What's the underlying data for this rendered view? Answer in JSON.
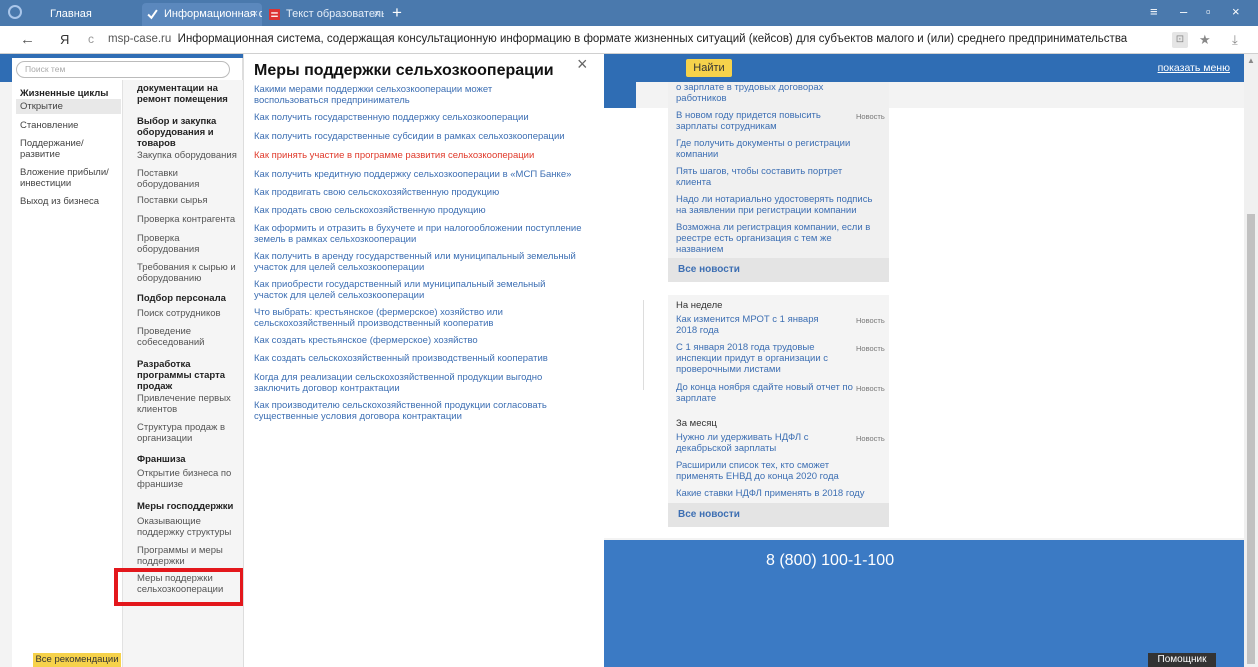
{
  "browser": {
    "tabs": [
      {
        "label": "Главная"
      },
      {
        "label": "Информационная систе",
        "close": "×"
      },
      {
        "label": "Текст образовательного ко",
        "close": "×"
      }
    ],
    "new_tab": "+",
    "window_controls": [
      "≡",
      "–",
      "▫",
      "×"
    ],
    "nav_back": "←",
    "nav_logo": "Я",
    "nav_reload": "c",
    "url_domain": "msp-case.ru",
    "url_title": "Информационная система, содержащая консультационную информацию в формате жизненных ситуаций (кейсов) для субъектов малого и (или) среднего предпринимательства",
    "bookmark": "★",
    "download": "⤓"
  },
  "header": {
    "search_placeholder": "Поиск тем",
    "find_button": "Найти",
    "show_menu": "показать меню"
  },
  "sidebar": {
    "title": "Жизненные циклы",
    "items": [
      "Открытие",
      "Становление",
      "Поддержание/ развитие",
      "Вложение прибыли/ инвестиции",
      "Выход из бизнеса"
    ],
    "sub": [
      {
        "t": "документации на ремонт помещения",
        "h": true
      },
      {
        "t": "Выбор и закупка оборудования и товаров",
        "h": true
      },
      {
        "t": "Закупка оборудования"
      },
      {
        "t": "Поставки оборудования"
      },
      {
        "t": "Поставки сырья"
      },
      {
        "t": "Проверка контрагента"
      },
      {
        "t": "Проверка оборудования"
      },
      {
        "t": "Требования к сырью и оборудованию"
      },
      {
        "t": "Подбор персонала",
        "h": true
      },
      {
        "t": "Поиск сотрудников"
      },
      {
        "t": "Проведение собеседований"
      },
      {
        "t": "Разработка программы старта продаж",
        "h": true
      },
      {
        "t": "Привлечение первых клиентов"
      },
      {
        "t": "Структура продаж в организации"
      },
      {
        "t": "Франшиза",
        "h": true
      },
      {
        "t": "Открытие бизнеса по франшизе"
      },
      {
        "t": "Меры господдержки",
        "h": true
      },
      {
        "t": "Оказывающие поддержку структуры"
      },
      {
        "t": "Программы и меры поддержки"
      },
      {
        "t": "Меры поддержки сельхозкооперации"
      }
    ],
    "all_recommendations": "Все рекомендации"
  },
  "popup": {
    "title": "Меры поддержки сельхозкооперации",
    "close": "×",
    "links": [
      "Какими мерами поддержки сельхозкооперации может воспользоваться предприниматель",
      "Как получить государственную поддержку сельхозкооперации",
      "Как получить государственные субсидии в рамках сельхозкооперации",
      "Как принять участие в программе развития сельхозкооперации",
      "Как получить кредитную поддержку сельхозкооперации в «МСП Банке»",
      "Как продвигать свою сельскохозяйственную продукцию",
      "Как продать свою сельскохозяйственную продукцию",
      "Как оформить и отразить в бухучете и при налогообложении поступление земель в рамках сельхозкооперации",
      "Как получить в аренду государственный или муниципальный земельный участок для целей сельхозкооперации",
      "Как приобрести государственный или муниципальный земельный участок для целей сельхозкооперации",
      "Что выбрать: крестьянское (фермерское) хозяйство или сельскохозяйственный производственный кооператив",
      "Как создать крестьянское (фермерское) хозяйство",
      "Как создать сельскохозяйственный производственный кооператив",
      "Когда для реализации сельскохозяйственной продукции выгодно заключить договор контрактации",
      "Как производителю сельскохозяйственной продукции согласовать существенные условия договора контрактации"
    ],
    "active_index": 3
  },
  "news": {
    "items": [
      {
        "t": "о зарплате в трудовых договорах работников",
        "badge": ""
      },
      {
        "t": "В новом году придется повысить зарплаты сотрудникам",
        "badge": "Новость"
      },
      {
        "t": "Где получить документы о регистрации компании",
        "badge": ""
      },
      {
        "t": "Пять шагов, чтобы составить портрет клиента",
        "badge": ""
      },
      {
        "t": "Надо ли нотариально удостоверять подпись на заявлении при регистрации компании",
        "badge": ""
      },
      {
        "t": "Возможна ли регистрация компании, если в реестре есть организация с тем же названием",
        "badge": ""
      }
    ],
    "all_news": "Все новости",
    "week_label": "На неделе",
    "week": [
      {
        "t": "Как изменится МРОТ с 1 января 2018 года",
        "badge": "Новость"
      },
      {
        "t": "С 1 января 2018 года трудовые инспекции придут в организации с проверочными листами",
        "badge": "Новость"
      },
      {
        "t": "До конца ноября сдайте новый отчет по зарплате",
        "badge": "Новость"
      }
    ],
    "month_label": "За месяц",
    "month": [
      {
        "t": "Нужно ли удерживать НДФЛ с декабрьской зарплаты",
        "badge": "Новость"
      },
      {
        "t": "Расширили список тех, кто сможет применять ЕНВД до конца 2020 года",
        "badge": ""
      },
      {
        "t": "Какие ставки НДФЛ применять в 2018 году",
        "badge": ""
      }
    ]
  },
  "footer": {
    "phone": "8 (800) 100-1-100",
    "helper": "Помощник"
  }
}
